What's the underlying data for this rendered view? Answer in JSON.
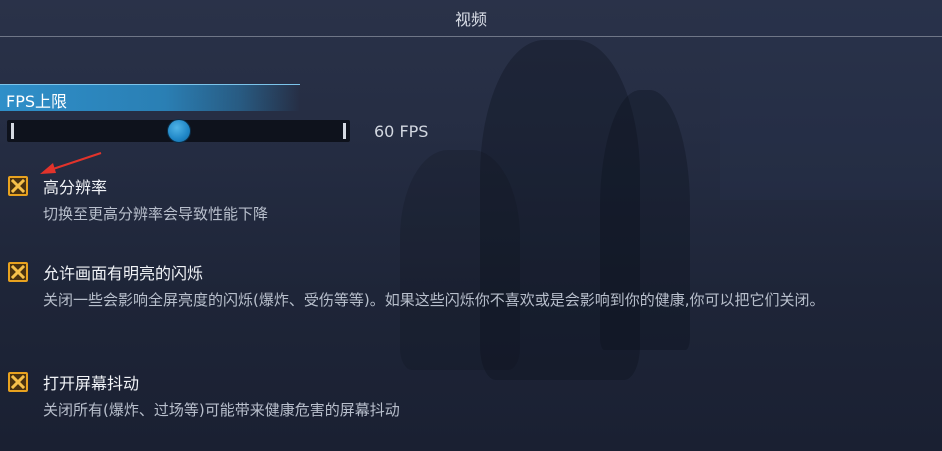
{
  "window": {
    "title": "视频"
  },
  "fps_section": {
    "header_label": "FPS上限",
    "slider_value_text": "60 FPS",
    "slider_fraction": 0.5
  },
  "options": [
    {
      "label": "高分辨率",
      "description": "切换至更高分辨率会导致性能下降",
      "checked": true
    },
    {
      "label": "允许画面有明亮的闪烁",
      "description": "关闭一些会影响全屏亮度的闪烁(爆炸、受伤等等)。如果这些闪烁你不喜欢或是会影响到你的健康,你可以把它们关闭。",
      "checked": true
    },
    {
      "label": "打开屏幕抖动",
      "description": "关闭所有(爆炸、过场等)可能带来健康危害的屏幕抖动",
      "checked": true
    }
  ],
  "colors": {
    "accent_blue": "#2f8fc9",
    "checkbox_orange": "#e8a21f",
    "annotation_red": "#e2332b"
  },
  "icons": {
    "checkbox": "x-mark-icon",
    "annotation": "red-arrow-icon"
  }
}
